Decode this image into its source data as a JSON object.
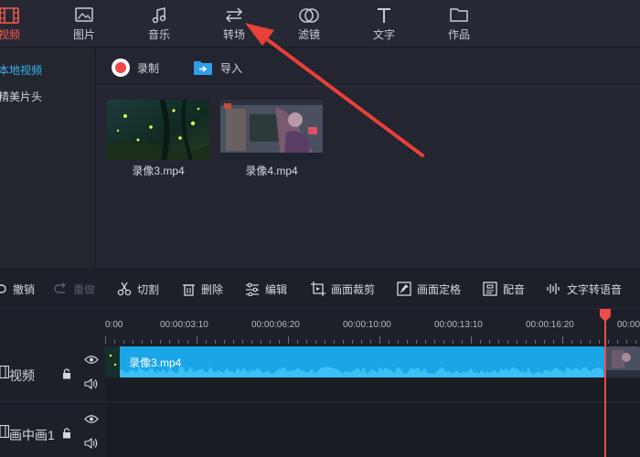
{
  "top_tabs": [
    {
      "label": "视频",
      "icon": "film-icon",
      "active": true
    },
    {
      "label": "图片",
      "icon": "image-icon"
    },
    {
      "label": "音乐",
      "icon": "music-note-icon"
    },
    {
      "label": "转场",
      "icon": "swap-arrows-icon"
    },
    {
      "label": "滤镜",
      "icon": "overlap-circles-icon"
    },
    {
      "label": "文字",
      "icon": "text-t-icon"
    },
    {
      "label": "作品",
      "icon": "folder-icon"
    }
  ],
  "sidebar": {
    "items": [
      {
        "label": "本地视频",
        "active": true
      },
      {
        "label": "精美片头"
      }
    ]
  },
  "media_toolbar": {
    "record_label": "录制",
    "import_label": "导入"
  },
  "media_items": [
    {
      "name": "录像3.mp4"
    },
    {
      "name": "录像4.mp4"
    }
  ],
  "edit_toolbar": [
    {
      "label": "撤销",
      "icon": "undo-icon"
    },
    {
      "label": "重做",
      "icon": "redo-icon",
      "disabled": true
    },
    {
      "label": "切割",
      "icon": "scissors-icon"
    },
    {
      "label": "删除",
      "icon": "trash-icon"
    },
    {
      "label": "编辑",
      "icon": "sliders-icon"
    },
    {
      "label": "画面裁剪",
      "icon": "crop-icon"
    },
    {
      "label": "画面定格",
      "icon": "freeze-frame-icon"
    },
    {
      "label": "配音",
      "icon": "voiceover-icon"
    },
    {
      "label": "文字转语音",
      "icon": "text-to-speech-icon"
    }
  ],
  "ruler": {
    "labels": [
      "0:00",
      "00:00:03:10",
      "00:00:06:20",
      "00:00:10:00",
      "00:00:13:10",
      "00:00:16:20",
      "00:00"
    ]
  },
  "tracks": [
    {
      "name": "视频",
      "icon": "film-icon"
    },
    {
      "name": "画中画1",
      "icon": "film-icon"
    }
  ],
  "timeline_clip": {
    "name": "录像3.mp4"
  },
  "colors": {
    "accent_active_tab": "#ff5b4d",
    "accent_sidebar": "#3ab3f0",
    "clip_blue": "#1aa6e6",
    "playhead": "#ef4b48",
    "annotation_arrow": "#e8403a"
  }
}
